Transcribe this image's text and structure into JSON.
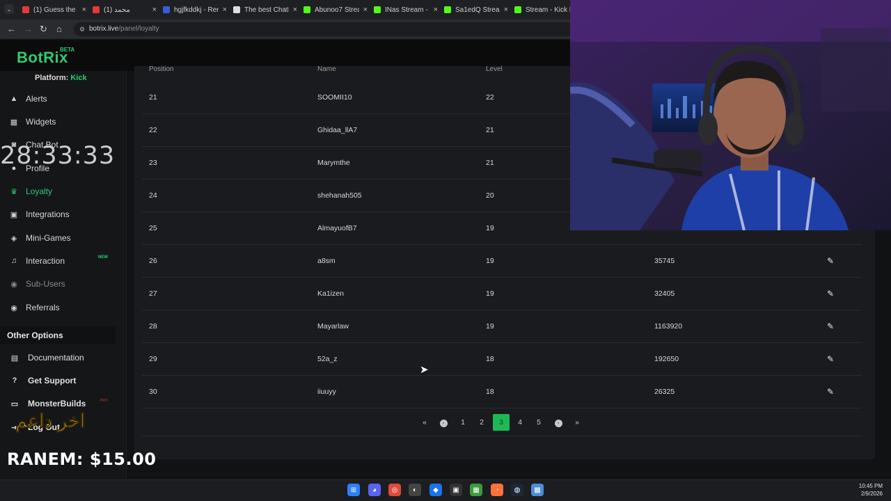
{
  "browser": {
    "tabs": [
      {
        "title": "(1) Guess the R",
        "color": "#e53935"
      },
      {
        "title": "(1) محمد",
        "color": "#e53935"
      },
      {
        "title": "hgjfkddkj - Rem",
        "color": "#3b5bdb"
      },
      {
        "title": "The best ChatB",
        "color": "#dddddd"
      },
      {
        "title": "Abunoo7 Strea",
        "color": "#53fc18"
      },
      {
        "title": "INas Stream - ",
        "color": "#53fc18"
      },
      {
        "title": "Sa1edQ Stream",
        "color": "#53fc18"
      },
      {
        "title": "Stream - Kick D",
        "color": "#53fc18"
      }
    ],
    "url_host": "botrix.live",
    "url_path": "/panel/loyalty"
  },
  "app": {
    "logo": "BotRix",
    "beta": "BETA",
    "platform_label": "Platform:",
    "platform_value": "Kick"
  },
  "sidebar": {
    "items": [
      {
        "label": "Alerts",
        "icon": "warning-icon",
        "glyph": "▲"
      },
      {
        "label": "Widgets",
        "icon": "grid-icon",
        "glyph": "▦"
      },
      {
        "label": "Chat Bot",
        "icon": "robot-icon",
        "glyph": "◙"
      },
      {
        "label": "Profile",
        "icon": "user-icon",
        "glyph": "●"
      },
      {
        "label": "Loyalty",
        "icon": "trophy-icon",
        "glyph": "♛"
      },
      {
        "label": "Integrations",
        "icon": "plug-icon",
        "glyph": "▣"
      },
      {
        "label": "Mini-Games",
        "icon": "gamepad-icon",
        "glyph": "◈"
      },
      {
        "label": "Interaction",
        "icon": "music-icon",
        "glyph": "♫"
      },
      {
        "label": "Sub-Users",
        "icon": "users-icon",
        "glyph": "◉"
      },
      {
        "label": "Referrals",
        "icon": "referrals-icon",
        "glyph": "◉"
      }
    ],
    "new_badge": "NEW",
    "pro_badge": "PRO",
    "other_options_title": "Other Options",
    "options": [
      {
        "label": "Documentation",
        "icon": "book-icon",
        "glyph": "▤"
      },
      {
        "label": "Get Support",
        "icon": "question-icon",
        "glyph": "?"
      },
      {
        "label": "MonsterBuilds",
        "icon": "monitor-icon",
        "glyph": "▭"
      },
      {
        "label": "Log Out",
        "icon": "logout-icon",
        "glyph": "⇥"
      }
    ]
  },
  "table": {
    "headers": [
      "Position",
      "Name",
      "Level"
    ],
    "rows": [
      {
        "position": "21",
        "name": "SOOMII10",
        "level": "22",
        "points": ""
      },
      {
        "position": "22",
        "name": "Ghidaa_llA7",
        "level": "21",
        "points": ""
      },
      {
        "position": "23",
        "name": "Marymthe",
        "level": "21",
        "points": ""
      },
      {
        "position": "24",
        "name": "shehanah505",
        "level": "20",
        "points": ""
      },
      {
        "position": "25",
        "name": "AlmayuofB7",
        "level": "19",
        "points": ""
      },
      {
        "position": "26",
        "name": "a8sm",
        "level": "19",
        "points": "35745"
      },
      {
        "position": "27",
        "name": "Ka1izen",
        "level": "19",
        "points": "32405"
      },
      {
        "position": "28",
        "name": "Mayarlaw",
        "level": "19",
        "points": "1163920"
      },
      {
        "position": "29",
        "name": "52a_z",
        "level": "18",
        "points": "192650"
      },
      {
        "position": "30",
        "name": "iiuuyy",
        "level": "18",
        "points": "26325"
      }
    ]
  },
  "pagination": {
    "first": "«",
    "prev": "‹",
    "pages": [
      "1",
      "2",
      "3",
      "4",
      "5"
    ],
    "current": "3",
    "next": "›",
    "last": "»"
  },
  "overlay": {
    "timer": "28:33:33",
    "arabic_text": "اخر داعم",
    "donation": "RANEM: $15.00"
  },
  "taskbar": {
    "time": "10:45 PM",
    "date": "2/9/2026"
  }
}
